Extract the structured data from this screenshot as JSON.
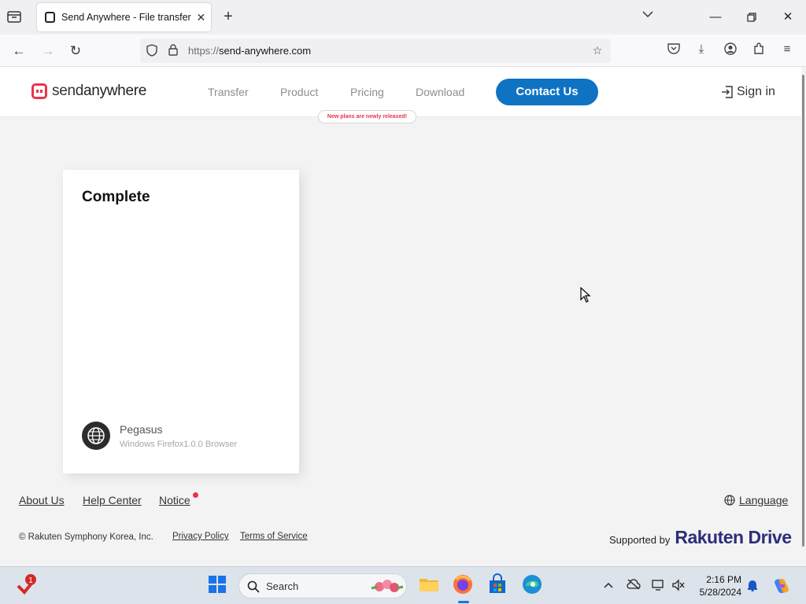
{
  "browser": {
    "tab_title": "Send Anywhere - File transfer",
    "url_protocol": "https://",
    "url_host": "send-anywhere.com"
  },
  "site": {
    "logo_send": "send",
    "logo_anywhere": "anywhere",
    "menu": [
      "Transfer",
      "Product",
      "Pricing",
      "Download"
    ],
    "pricing_badge": "New plans are newly released!",
    "contact_label": "Contact Us",
    "signin_label": "Sign in"
  },
  "card": {
    "title": "Complete",
    "device_name": "Pegasus",
    "device_desc": "Windows Firefox1.0.0 Browser"
  },
  "footer": {
    "about": "About Us",
    "help": "Help Center",
    "notice": "Notice",
    "language": "Language",
    "copyright": "© Rakuten Symphony Korea, Inc.",
    "privacy": "Privacy Policy",
    "terms": "Terms of Service",
    "supported_by": "Supported by",
    "brand_rakuten": "Rakuten",
    "brand_drive": "Drive"
  },
  "taskbar": {
    "search_label": "Search",
    "time": "2:16 PM",
    "date": "5/28/2024",
    "notification_count": "1"
  },
  "colors": {
    "accent_blue": "#0f73c4",
    "brand_red": "#e9344b",
    "rakuten_navy": "#2d2d7c"
  }
}
